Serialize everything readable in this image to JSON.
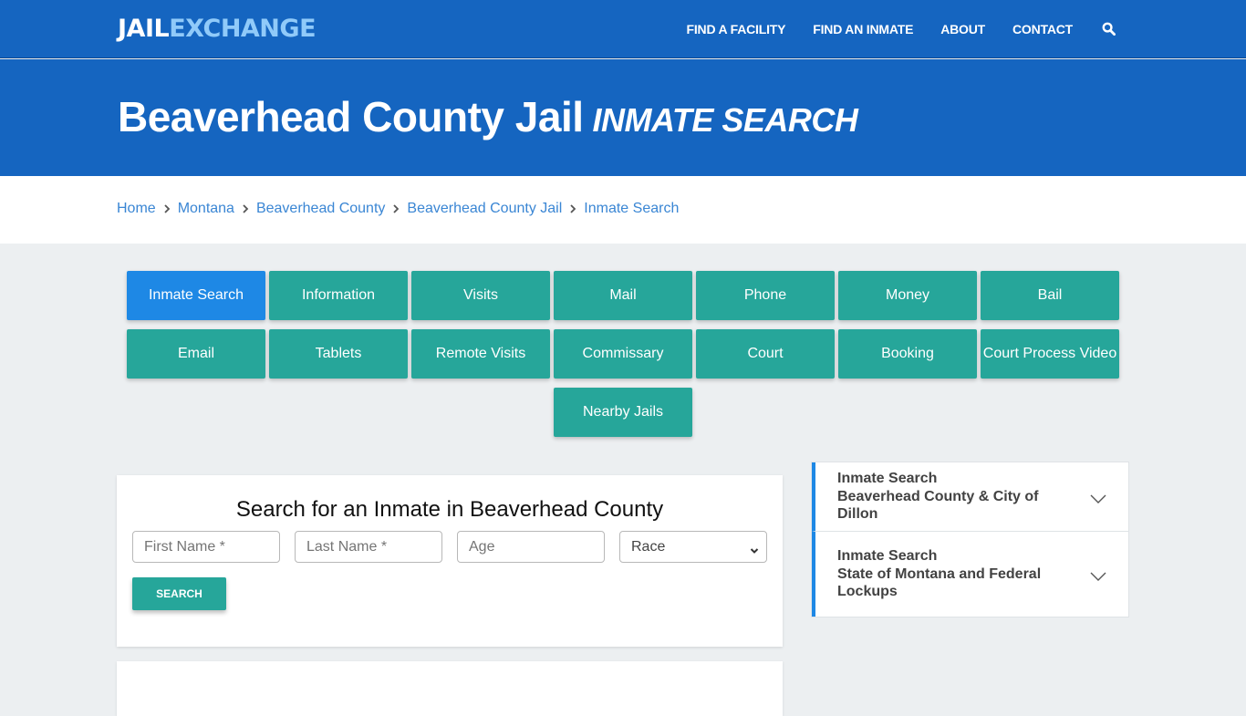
{
  "brand": {
    "logo_part1": "JAIL",
    "logo_part2": "EXCHANGE",
    "colors": {
      "primary": "#1565c0",
      "logo_accent": "#90caf9",
      "teal": "#26a69a",
      "active_tab": "#1e88e5",
      "link": "#3a86d4"
    }
  },
  "nav": {
    "links": [
      "FIND A FACILITY",
      "FIND AN INMATE",
      "ABOUT",
      "CONTACT"
    ],
    "search_icon": "search-icon"
  },
  "hero": {
    "title": "Beaverhead County Jail",
    "subtitle": "INMATE SEARCH"
  },
  "breadcrumb": [
    "Home",
    "Montana",
    "Beaverhead County",
    "Beaverhead County Jail",
    "Inmate Search"
  ],
  "tabs": {
    "active": "Inmate Search",
    "items": [
      "Inmate Search",
      "Information",
      "Visits",
      "Mail",
      "Phone",
      "Money",
      "Bail",
      "Email",
      "Tablets",
      "Remote Visits",
      "Commissary",
      "Court",
      "Booking",
      "Court Process Video",
      "Nearby Jails"
    ]
  },
  "search_form": {
    "heading": "Search for an Inmate in Beaverhead County",
    "first_name_placeholder": "First Name *",
    "last_name_placeholder": "Last Name *",
    "age_placeholder": "Age",
    "race_selected": "Race",
    "button_label": "SEARCH"
  },
  "accordion": [
    {
      "line1": "Inmate Search",
      "line2": "Beaverhead County & City of Dillon"
    },
    {
      "line1": "Inmate Search",
      "line2": "State of Montana and Federal Lockups"
    }
  ]
}
